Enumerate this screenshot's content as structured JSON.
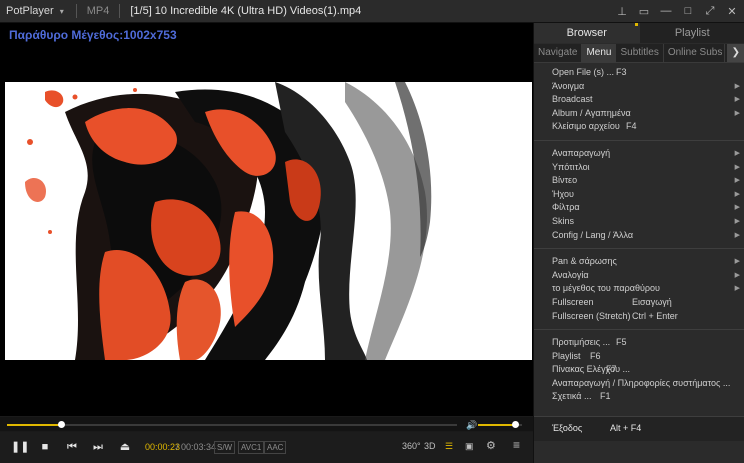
{
  "titlebar": {
    "app_name": "PotPlayer",
    "format": "MP4",
    "title": "[1/5] 10 Incredible 4K (Ultra HD) Videos(1).mp4"
  },
  "video": {
    "osd_text": "Παράθυρο Μέγεθος:1002x753",
    "progress": 0.12,
    "volume": 0.85
  },
  "controls": {
    "current_time": "00:00:23",
    "total_time": "/ 00:03:34",
    "tag_sw": "S/W",
    "tag_codec": "AVC1",
    "tag_audio": "AAC",
    "icon_360": "360°",
    "icon_3d": "3D"
  },
  "panel": {
    "tabs": [
      "Browser",
      "Playlist"
    ],
    "subtabs": [
      "Navigate",
      "Menu",
      "Subtitles",
      "Online Subs Dat"
    ],
    "groups": [
      [
        {
          "label": "Open File (s) ...",
          "shortcut": "F3",
          "arrow": false
        },
        {
          "label": "Άνοιγμα",
          "shortcut": "",
          "arrow": true
        },
        {
          "label": "Broadcast",
          "shortcut": "",
          "arrow": true
        },
        {
          "label": "Album / Αγαπημένα",
          "shortcut": "",
          "arrow": true
        },
        {
          "label": "Κλείσιμο αρχείου",
          "shortcut": "F4",
          "arrow": false
        }
      ],
      [
        {
          "label": "Αναπαραγωγή",
          "shortcut": "",
          "arrow": true
        },
        {
          "label": "Υπότιτλοι",
          "shortcut": "",
          "arrow": true
        },
        {
          "label": "Βίντεο",
          "shortcut": "",
          "arrow": true
        },
        {
          "label": "Ήχου",
          "shortcut": "",
          "arrow": true
        },
        {
          "label": "Φίλτρα",
          "shortcut": "",
          "arrow": true
        },
        {
          "label": "Skins",
          "shortcut": "",
          "arrow": true
        },
        {
          "label": "Config / Lang / Άλλα",
          "shortcut": "",
          "arrow": true
        }
      ],
      [
        {
          "label": "Pan & σάρωσης",
          "shortcut": "",
          "arrow": true
        },
        {
          "label": "Αναλογία",
          "shortcut": "",
          "arrow": true
        },
        {
          "label": "το μέγεθος του παραθύρου",
          "shortcut": "",
          "arrow": true
        },
        {
          "label": "Fullscreen",
          "shortcut": "Εισαγωγή",
          "arrow": false
        },
        {
          "label": "Fullscreen (Stretch)",
          "shortcut": "Ctrl + Enter",
          "arrow": false
        }
      ],
      [
        {
          "label": "Προτιμήσεις ...",
          "shortcut": "F5",
          "arrow": false
        },
        {
          "label": "Playlist",
          "shortcut": "F6",
          "arrow": false
        },
        {
          "label": "Πίνακας Ελέγχου ...",
          "shortcut": "F7",
          "arrow": false
        },
        {
          "label": "Αναπαραγωγή / Πληροφορίες συστήματος ...",
          "shortcut": "",
          "arrow": false
        },
        {
          "label": "Σχετικά ...",
          "shortcut": "F1",
          "arrow": false
        }
      ]
    ],
    "exit": {
      "label": "Έξοδος",
      "shortcut": "Alt + F4"
    }
  },
  "colors": {
    "accent": "#e0b800",
    "osd": "#4f6bd8"
  }
}
